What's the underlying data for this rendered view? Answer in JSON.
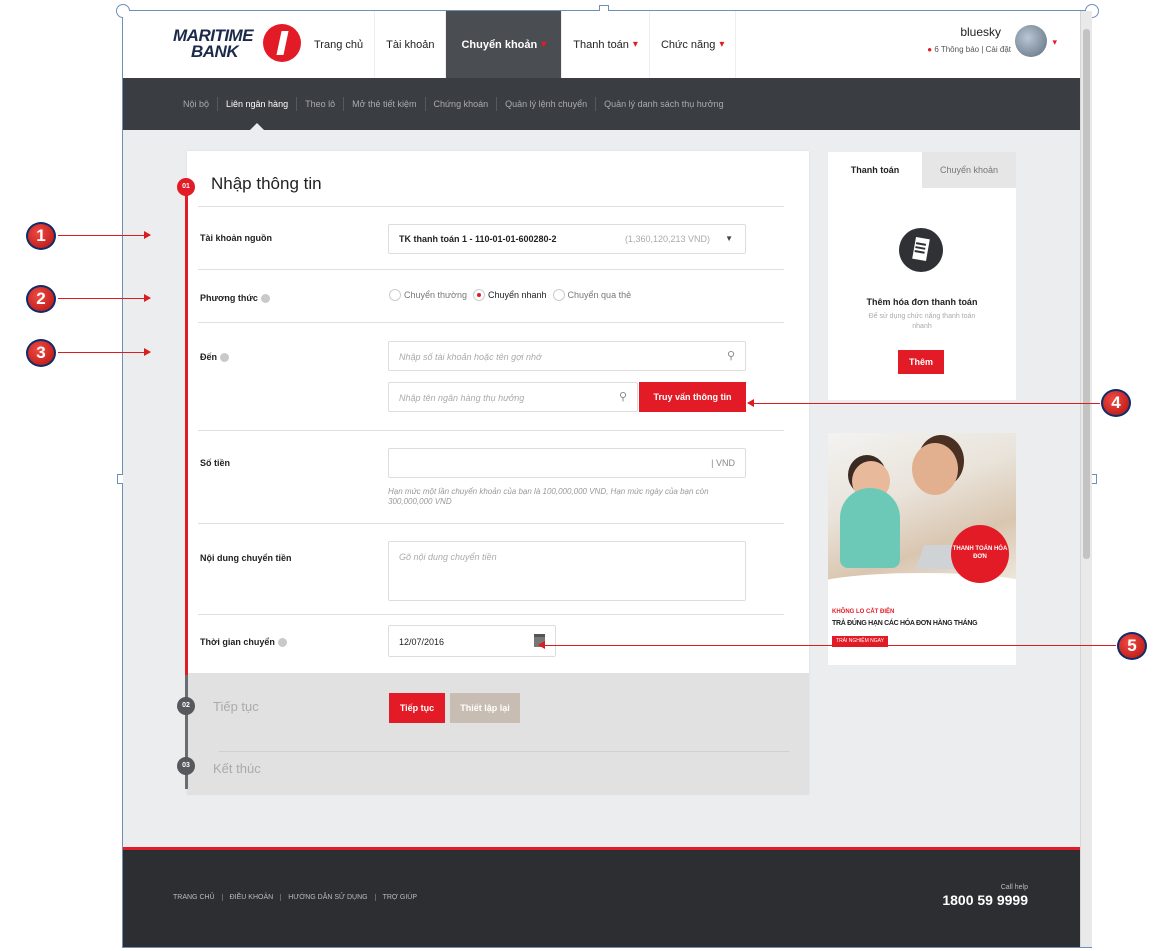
{
  "header": {
    "logo_line1": "MARITIME",
    "logo_line2": "BANK",
    "nav": [
      {
        "label": "Trang chủ",
        "dropdown": false,
        "active": false
      },
      {
        "label": "Tài khoản",
        "dropdown": false,
        "active": false
      },
      {
        "label": "Chuyển khoản",
        "dropdown": true,
        "active": true
      },
      {
        "label": "Thanh toán",
        "dropdown": true,
        "active": false
      },
      {
        "label": "Chức năng",
        "dropdown": true,
        "active": false
      }
    ],
    "caret": "▾",
    "user_name": "bluesky",
    "notifications": "6 Thông báo",
    "settings": "Cài đặt",
    "separator": "|"
  },
  "subnav": [
    {
      "label": "Nội bộ",
      "active": false
    },
    {
      "label": "Liên ngân hàng",
      "active": true
    },
    {
      "label": "Theo lô",
      "active": false
    },
    {
      "label": "Mở thẻ tiết kiệm",
      "active": false
    },
    {
      "label": "Chứng khoán",
      "active": false
    },
    {
      "label": "Quản lý lệnh chuyển",
      "active": false
    },
    {
      "label": "Quản lý danh sách thụ hưởng",
      "active": false
    }
  ],
  "form": {
    "step1_number": "01",
    "step1_title": "Nhập thông tin",
    "source_label": "Tài khoản nguồn",
    "source_value": "TK thanh toán 1 - 110-01-01-600280-2",
    "source_balance": "(1,360,120,213 VND)",
    "method_label": "Phương thức",
    "methods": [
      {
        "label": "Chuyển thường",
        "checked": false
      },
      {
        "label": "Chuyển nhanh",
        "checked": true
      },
      {
        "label": "Chuyển qua thẻ",
        "checked": false
      }
    ],
    "to_label": "Đến",
    "to_account_placeholder": "Nhập số tài khoản hoặc tên gợi nhớ",
    "bank_placeholder": "Nhập tên ngân hàng thụ hưởng",
    "lookup_button": "Truy vấn thông tin",
    "amount_label": "Số tiền",
    "amount_unit": "| VND",
    "amount_hint": "Hạn mức một lần chuyển khoản của bạn là 100,000,000 VND, Hạn mức ngày của bạn còn 300,000,000 VND",
    "content_label": "Nội dung chuyển tiền",
    "content_placeholder": "Gõ nội dung chuyển tiền",
    "time_label": "Thời gian chuyển",
    "time_value": "12/07/2016",
    "step2_number": "02",
    "step2_title": "Tiếp tục",
    "continue_button": "Tiếp tục",
    "reset_button": "Thiết lập lại",
    "step3_number": "03",
    "step3_title": "Kết thúc"
  },
  "side_panel": {
    "tab_active": "Thanh toán",
    "tab_inactive": "Chuyển khoản",
    "title": "Thêm hóa đơn thanh toán",
    "desc": "Để sử dụng chức năng thanh toán nhanh",
    "button": "Thêm"
  },
  "banner": {
    "badge": "THANH TOÁN HÓA ĐƠN",
    "line1": "KHÔNG LO CẮT ĐIỆN",
    "line2": "TRẢ ĐÚNG HẠN CÁC HÓA ĐƠN HÀNG THÁNG",
    "cta": "TRẢI NGHIỆM NGAY"
  },
  "footer": {
    "links": [
      "TRANG CHỦ",
      "ĐIỀU KHOẢN",
      "HƯỚNG DẪN SỬ DỤNG",
      "TRỢ GIÚP"
    ],
    "call_help": "Call help",
    "hotline": "1800 59 9999"
  },
  "annotations": [
    "1",
    "2",
    "3",
    "4",
    "5"
  ],
  "colors": {
    "brand_red": "#e21b26",
    "nav_dark": "#3a3d42",
    "annotation_border": "#0d2c6a"
  }
}
